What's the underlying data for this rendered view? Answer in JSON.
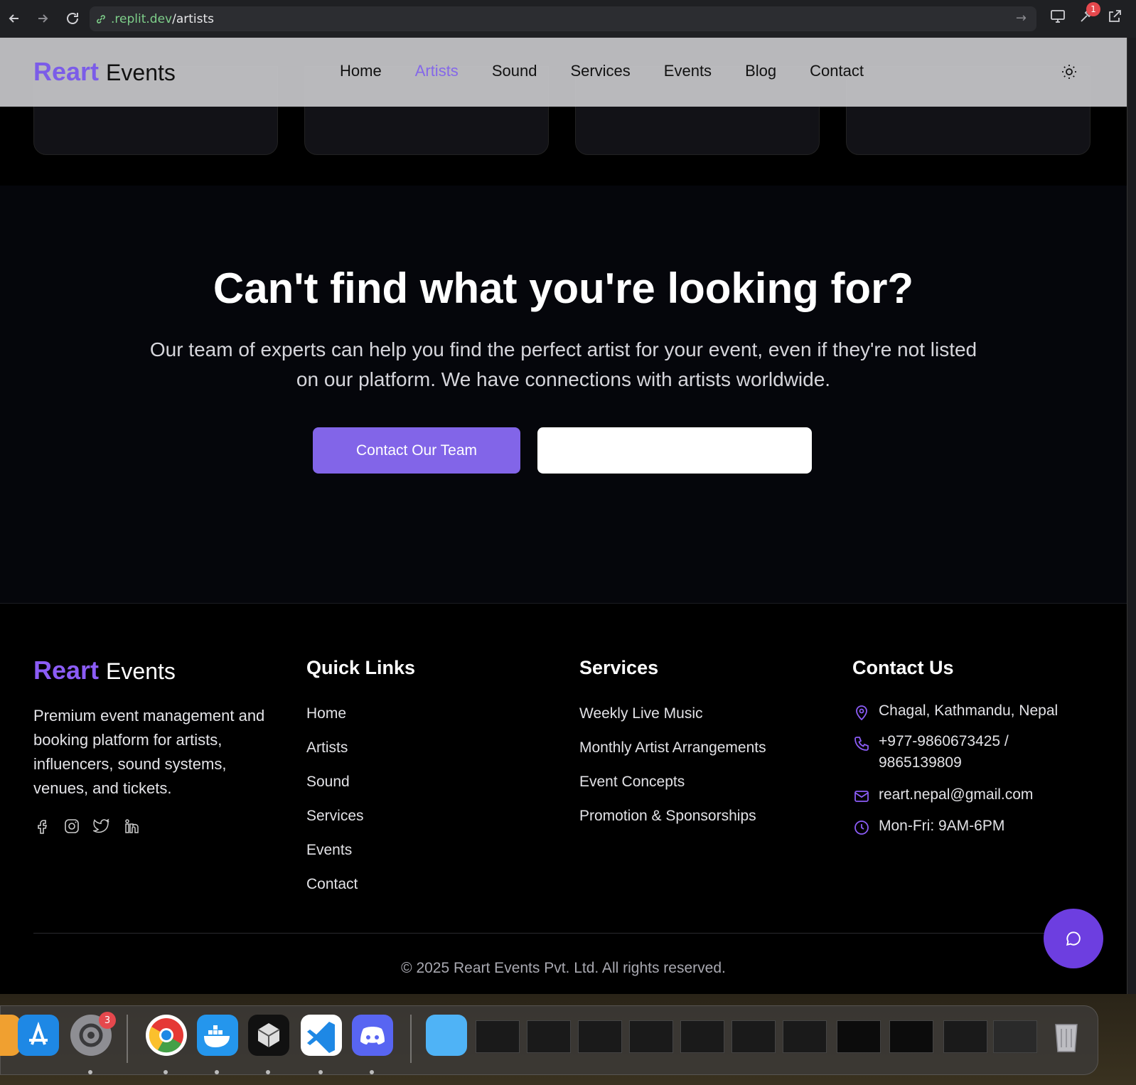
{
  "browser": {
    "url_domain": ".replit.dev",
    "url_path": "/artists",
    "notification_count": "1"
  },
  "navbar": {
    "logo_brand": "Reart",
    "logo_suffix": "Events",
    "links": [
      "Home",
      "Artists",
      "Sound",
      "Services",
      "Events",
      "Blog",
      "Contact"
    ],
    "active_link": "Artists"
  },
  "cta": {
    "title": "Can't find what you're looking for?",
    "text": "Our team of experts can help you find the perfect artist for your event, even if they're not listed on our platform. We have connections with artists worldwide.",
    "primary_button": "Contact Our Team",
    "secondary_button": ""
  },
  "footer": {
    "logo_brand": "Reart",
    "logo_suffix": "Events",
    "description": "Premium event management and booking platform for artists, influencers, sound systems, venues, and tickets.",
    "socials": [
      "facebook-icon",
      "instagram-icon",
      "twitter-icon",
      "linkedin-icon"
    ],
    "quick_links_title": "Quick Links",
    "quick_links": [
      "Home",
      "Artists",
      "Sound",
      "Services",
      "Events",
      "Contact"
    ],
    "services_title": "Services",
    "services": [
      "Weekly Live Music",
      "Monthly Artist Arrangements",
      "Event Concepts",
      "Promotion & Sponsorships"
    ],
    "contact_title": "Contact Us",
    "contact": {
      "address": "Chagal, Kathmandu, Nepal",
      "phone_line1": "+977-9860673425 /",
      "phone_line2": "9865139809",
      "email": "reart.nepal@gmail.com",
      "hours": "Mon-Fri: 9AM-6PM"
    },
    "copyright": "© 2025 Reart Events Pvt. Ltd. All rights reserved."
  },
  "dock": {
    "settings_badge": "3"
  },
  "colors": {
    "accent": "#8265e8",
    "brand": "#8b5cf6",
    "chat_button": "#6d3ee0"
  }
}
